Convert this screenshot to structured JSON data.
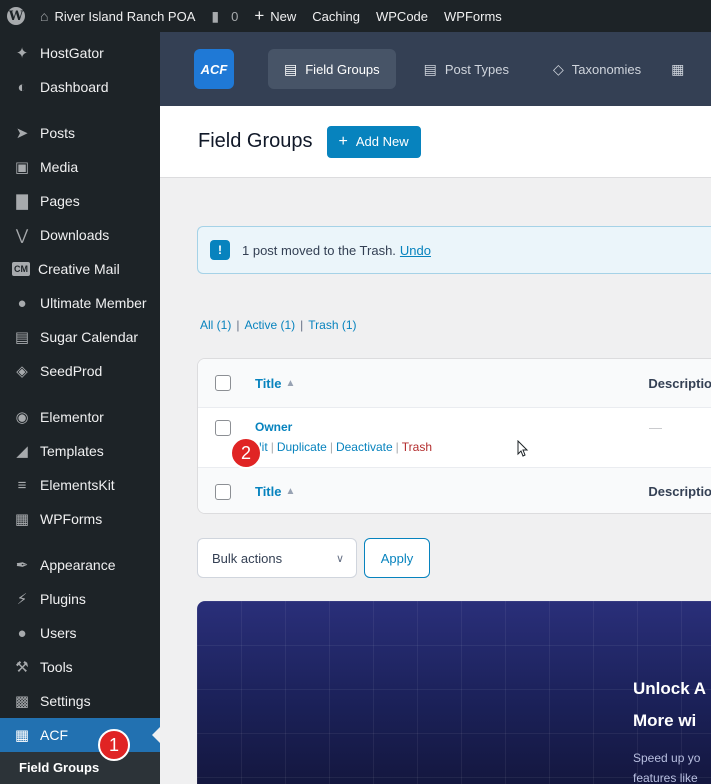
{
  "adminbar": {
    "site_name": "River Island Ranch POA",
    "comments_count": "0",
    "new_label": "New",
    "items": [
      "Caching",
      "WPCode",
      "WPForms"
    ]
  },
  "sidebar": {
    "items": [
      {
        "label": "HostGator",
        "icon": "hostgator-icon"
      },
      {
        "label": "Dashboard",
        "icon": "dashboard-icon"
      },
      {
        "label": "Posts",
        "icon": "pin-icon"
      },
      {
        "label": "Media",
        "icon": "media-icon"
      },
      {
        "label": "Pages",
        "icon": "page-icon"
      },
      {
        "label": "Downloads",
        "icon": "downloads-icon"
      },
      {
        "label": "Creative Mail",
        "icon": "cm-icon"
      },
      {
        "label": "Ultimate Member",
        "icon": "user-icon"
      },
      {
        "label": "Sugar Calendar",
        "icon": "calendar-icon"
      },
      {
        "label": "SeedProd",
        "icon": "seedprod-icon"
      },
      {
        "label": "Elementor",
        "icon": "elementor-icon"
      },
      {
        "label": "Templates",
        "icon": "folder-icon"
      },
      {
        "label": "ElementsKit",
        "icon": "elementskit-icon"
      },
      {
        "label": "WPForms",
        "icon": "form-icon"
      },
      {
        "label": "Appearance",
        "icon": "brush-icon"
      },
      {
        "label": "Plugins",
        "icon": "plug-icon"
      },
      {
        "label": "Users",
        "icon": "users-icon"
      },
      {
        "label": "Tools",
        "icon": "wrench-icon"
      },
      {
        "label": "Settings",
        "icon": "settings-icon"
      },
      {
        "label": "ACF",
        "icon": "acf-table-icon"
      }
    ],
    "submenu_label": "Field Groups"
  },
  "badges": {
    "one": "1",
    "two": "2"
  },
  "acf": {
    "logo": "ACF",
    "tabs": [
      {
        "label": "Field Groups",
        "icon": "list-icon"
      },
      {
        "label": "Post Types",
        "icon": "document-icon"
      },
      {
        "label": "Taxonomies",
        "icon": "tag-icon"
      }
    ]
  },
  "page": {
    "title": "Field Groups",
    "add_new": "Add New"
  },
  "notice": {
    "text": "1 post moved to the Trash.",
    "undo": "Undo"
  },
  "filters": {
    "all": "All (1)",
    "active": "Active (1)",
    "trash": "Trash (1)"
  },
  "table": {
    "col_title": "Title",
    "col_description": "Descriptio",
    "row": {
      "title": "Owner",
      "description": "—",
      "actions": {
        "edit": "dit",
        "duplicate": "Duplicate",
        "deactivate": "Deactivate",
        "trash": "Trash"
      }
    }
  },
  "bulk": {
    "select": "Bulk actions",
    "apply": "Apply"
  },
  "promo": {
    "heading1": "Unlock A",
    "heading2": "More wi",
    "text1": "Speed up yo",
    "text2": "features like"
  },
  "colors": {
    "accent": "#0783be",
    "sidebar_bg": "#1d2327",
    "acf_header": "#344054",
    "badge": "#e02424"
  }
}
